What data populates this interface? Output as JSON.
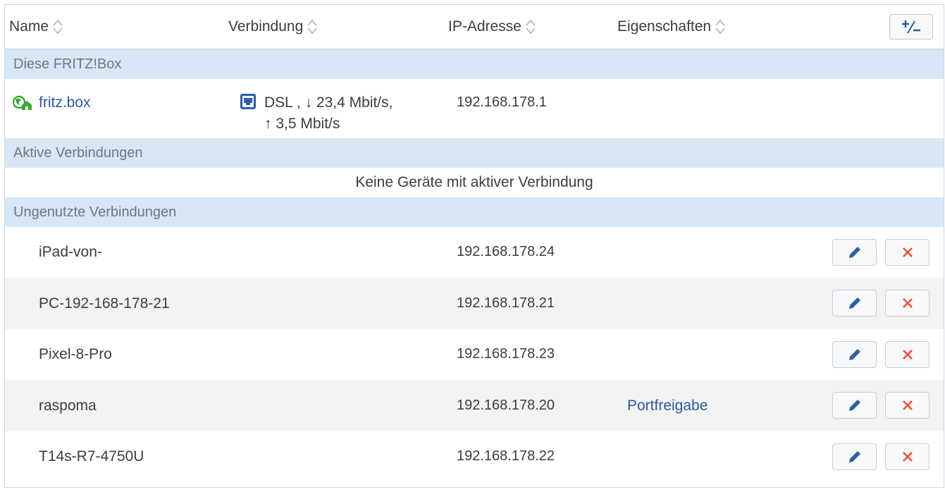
{
  "header": {
    "name": "Name",
    "verbindung": "Verbindung",
    "ip": "IP-Adresse",
    "eigenschaften": "Eigenschaften",
    "add_icon": "plus-minus-icon"
  },
  "sections": {
    "this_box": "Diese FRITZ!Box",
    "active": "Aktive Verbindungen",
    "unused": "Ungenutzte Verbindungen"
  },
  "fritzbox": {
    "name": "fritz.box",
    "connection_line1": "DSL , ↓ 23,4 Mbit/s,",
    "connection_line2": "↑ 3,5 Mbit/s",
    "ip": "192.168.178.1"
  },
  "active_empty": "Keine Geräte mit aktiver Verbindung",
  "devices": [
    {
      "name": "iPad-von-",
      "ip": "192.168.178.24",
      "props": ""
    },
    {
      "name": "PC-192-168-178-21",
      "ip": "192.168.178.21",
      "props": ""
    },
    {
      "name": "Pixel-8-Pro",
      "ip": "192.168.178.23",
      "props": ""
    },
    {
      "name": "raspoma",
      "ip": "192.168.178.20",
      "props": "Portfreigabe"
    },
    {
      "name": "T14s-R7-4750U",
      "ip": "192.168.178.22",
      "props": ""
    }
  ],
  "colors": {
    "section_bg": "#d7e7f6",
    "link": "#2b5a9b",
    "edit_icon": "#2d5fa6",
    "delete_icon": "#e8523c",
    "globe_icon": "#3aa935"
  }
}
